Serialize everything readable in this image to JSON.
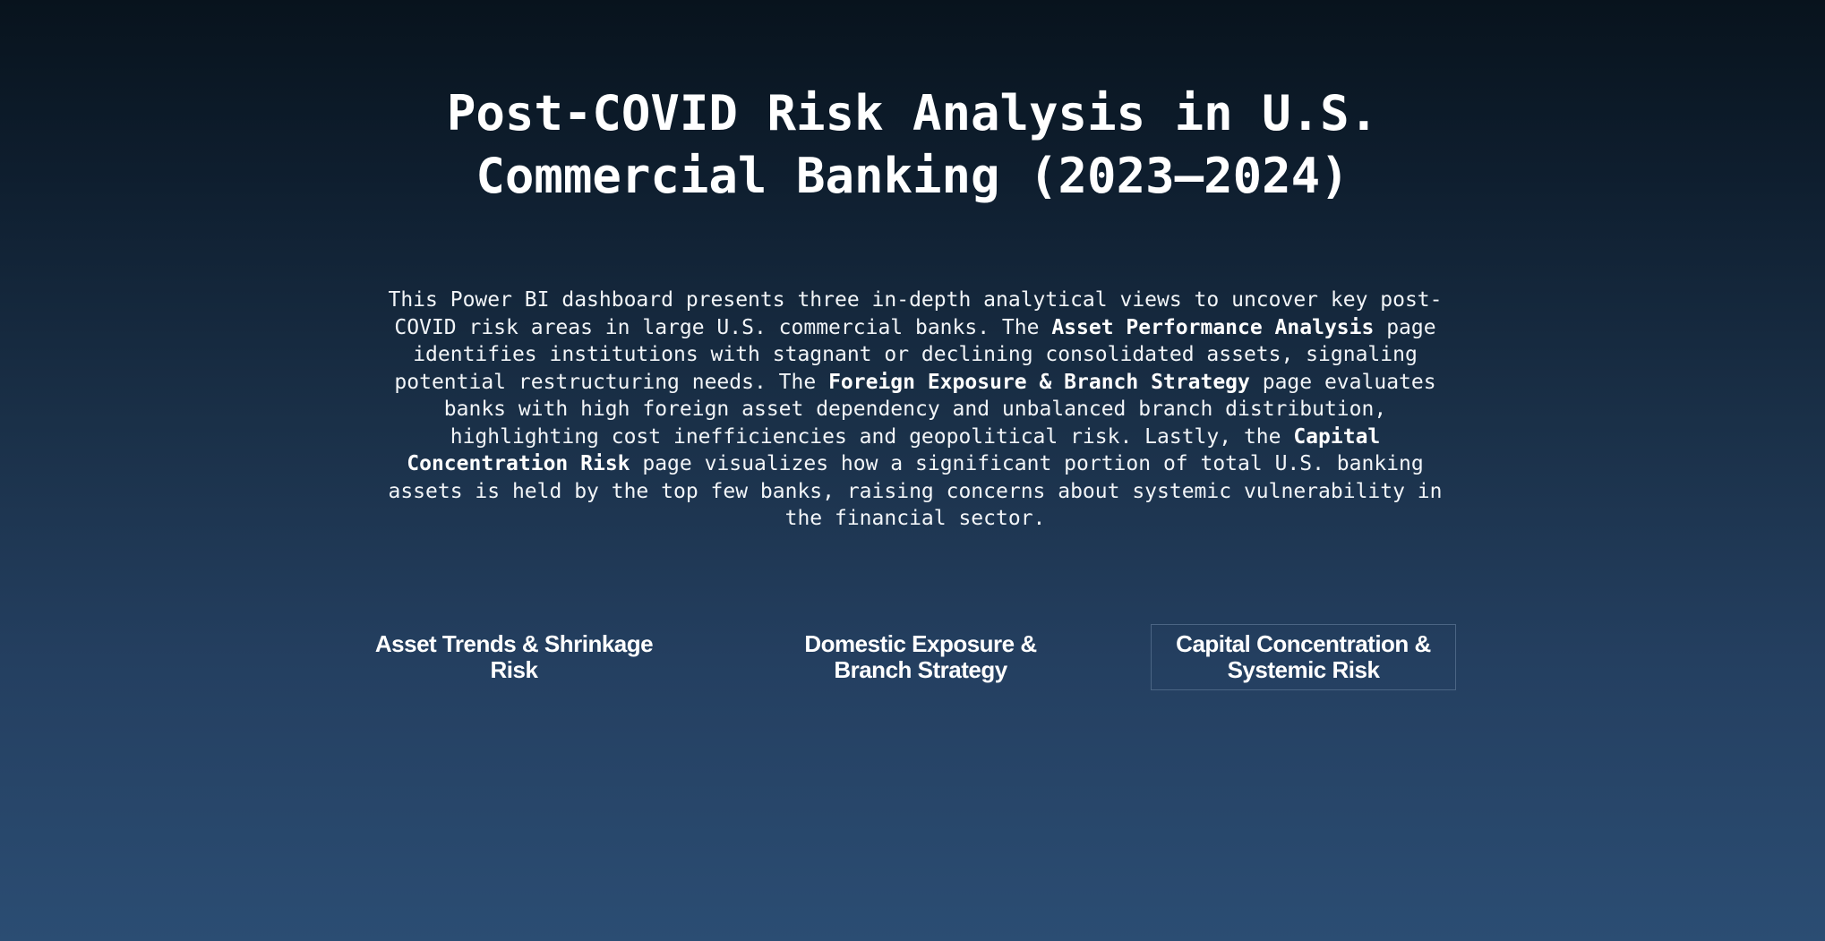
{
  "header": {
    "title_line1": "Post-COVID Risk Analysis in U.S.",
    "title_line2": "Commercial Banking (2023–2024)"
  },
  "description": {
    "part1": "This Power BI dashboard presents three in-depth analytical views to uncover key post-COVID risk areas in large U.S. commercial banks. The ",
    "bold1": "Asset Performance Analysis",
    "part2": " page identifies institutions with stagnant or declining consolidated assets, signaling potential restructuring needs. The ",
    "bold2": "Foreign Exposure & Branch Strategy",
    "part3": " page evaluates banks with high foreign asset dependency and unbalanced branch distribution, highlighting cost inefficiencies and geopolitical risk. Lastly, the ",
    "bold3": "Capital Concentration Risk",
    "part4": " page visualizes how a significant portion of total U.S. banking assets is held by the top few banks, raising concerns about systemic vulnerability in the financial sector."
  },
  "nav": {
    "buttons": [
      {
        "line1": "Asset Trends & Shrinkage",
        "line2": "Risk",
        "active": false
      },
      {
        "line1": "Domestic Exposure &",
        "line2": "Branch Strategy",
        "active": false
      },
      {
        "line1": "Capital Concentration &",
        "line2": "Systemic Risk",
        "active": true
      }
    ]
  },
  "colors": {
    "background_top": "#08131d",
    "background_bottom": "#2b4d73",
    "text": "#ffffff",
    "active_border": "#4b6584"
  }
}
